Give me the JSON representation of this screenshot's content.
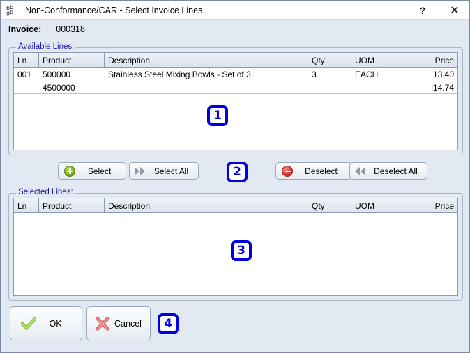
{
  "window": {
    "title": "Non-Conformance/CAR - Select Invoice Lines",
    "icon": "app-window-icon",
    "help_label": "?",
    "close_label": "✕"
  },
  "invoice": {
    "label": "Invoice:",
    "value": "000318"
  },
  "available": {
    "legend": "Available Lines:",
    "columns": [
      "Ln",
      "Product",
      "Description",
      "Qty",
      "UOM",
      "",
      "Price"
    ],
    "rows": [
      {
        "ln": "001",
        "product": "500000",
        "description": "Stainless Steel Mixing Bowls - Set of 3",
        "qty": "3",
        "uom": "EACH",
        "blank": "",
        "price": "13.40"
      },
      {
        "ln": "",
        "product": "4500000",
        "description": "",
        "qty": "",
        "uom": "",
        "blank": "",
        "price": "i14.74"
      }
    ]
  },
  "selected": {
    "legend": "Selected Lines:",
    "columns": [
      "Ln",
      "Product",
      "Description",
      "Qty",
      "UOM",
      "",
      "Price"
    ],
    "rows": []
  },
  "transfer_buttons": {
    "select": {
      "label": "Select",
      "icon": "green-plus-circle-icon"
    },
    "select_all": {
      "label": "Select All",
      "icon": "double-chevron-right-icon"
    },
    "deselect": {
      "label": "Deselect",
      "icon": "red-minus-circle-icon"
    },
    "deselect_all": {
      "label": "Deselect All",
      "icon": "double-chevron-left-icon"
    }
  },
  "dialog_buttons": {
    "ok": {
      "label": "OK",
      "icon": "green-check-icon"
    },
    "cancel": {
      "label": "Cancel",
      "icon": "red-x-icon"
    }
  },
  "annotations": [
    {
      "id": "1",
      "label": "1"
    },
    {
      "id": "2",
      "label": "2"
    },
    {
      "id": "3",
      "label": "3"
    },
    {
      "id": "4",
      "label": "4"
    }
  ],
  "colors": {
    "accent_blue": "#1a1aa8",
    "annotation_blue": "#0000e0",
    "window_bg": "#e3e9f2",
    "grid_bg": "#ffffff",
    "green": "#7fb524",
    "red": "#dd3a3a"
  }
}
